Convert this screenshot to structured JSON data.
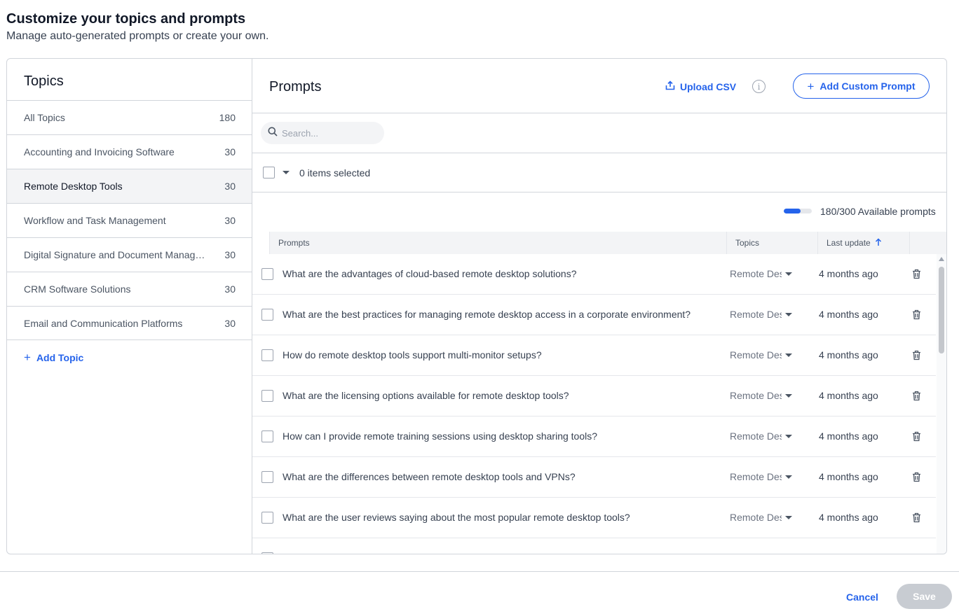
{
  "header": {
    "title": "Customize your topics and prompts",
    "subtitle": "Manage auto-generated prompts or create your own."
  },
  "topics": {
    "title": "Topics",
    "items": [
      {
        "label": "All Topics",
        "count": "180"
      },
      {
        "label": "Accounting and Invoicing Software",
        "count": "30"
      },
      {
        "label": "Remote Desktop Tools",
        "count": "30"
      },
      {
        "label": "Workflow and Task Management",
        "count": "30"
      },
      {
        "label": "Digital Signature and Document Manage...",
        "count": "30"
      },
      {
        "label": "CRM Software Solutions",
        "count": "30"
      },
      {
        "label": "Email and Communication Platforms",
        "count": "30"
      }
    ],
    "add_label": "Add Topic"
  },
  "prompts": {
    "title": "Prompts",
    "upload_label": "Upload CSV",
    "add_label": "Add Custom Prompt",
    "search_placeholder": "Search...",
    "selected_text": "0 items selected",
    "quota_text": "180/300 Available prompts",
    "quota_fraction": 0.6,
    "columns": {
      "prompts": "Prompts",
      "topics": "Topics",
      "last_update": "Last update"
    },
    "rows": [
      {
        "text": "What are the advantages of cloud-based remote desktop solutions?",
        "topic": "Remote Desktop Tools",
        "updated": "4 months ago"
      },
      {
        "text": "What are the best practices for managing remote desktop access in a corporate environment?",
        "topic": "Remote Desktop Tools",
        "updated": "4 months ago"
      },
      {
        "text": "How do remote desktop tools support multi-monitor setups?",
        "topic": "Remote Desktop Tools",
        "updated": "4 months ago"
      },
      {
        "text": "What are the licensing options available for remote desktop tools?",
        "topic": "Remote Desktop Tools",
        "updated": "4 months ago"
      },
      {
        "text": "How can I provide remote training sessions using desktop sharing tools?",
        "topic": "Remote Desktop Tools",
        "updated": "4 months ago"
      },
      {
        "text": "What are the differences between remote desktop tools and VPNs?",
        "topic": "Remote Desktop Tools",
        "updated": "4 months ago"
      },
      {
        "text": "What are the user reviews saying about the most popular remote desktop tools?",
        "topic": "Remote Desktop Tools",
        "updated": "4 months ago"
      }
    ]
  },
  "footer": {
    "cancel_label": "Cancel",
    "save_label": "Save"
  },
  "icons": {
    "upload": "upload-icon",
    "info": "info-icon",
    "search": "search-icon",
    "trash": "trash-icon",
    "sort": "arrow-up-icon"
  },
  "colors": {
    "accent": "#2563eb",
    "disabled": "#c8ccd2",
    "active_row": "#f3f4f6"
  }
}
